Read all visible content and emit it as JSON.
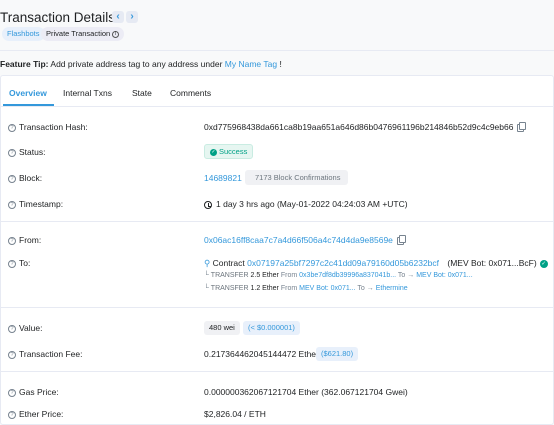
{
  "header": {
    "title": "Transaction Details",
    "prev_symbol": "‹",
    "next_symbol": "›",
    "badges": [
      "Flashbots",
      "Private Transaction"
    ]
  },
  "feature_tip": {
    "label": "Feature Tip:",
    "text": "Add private address tag to any address under",
    "link": "My Name Tag",
    "end": "!"
  },
  "tabs": [
    "Overview",
    "Internal Txns",
    "State",
    "Comments"
  ],
  "rows": {
    "tx_hash": {
      "label": "Transaction Hash:",
      "value": "0xd775968438da661ca8b19aa651a646d86b0476961196b214846b52d9c4c9eb66"
    },
    "status": {
      "label": "Status:",
      "value": "Success"
    },
    "block": {
      "label": "Block:",
      "value": "14689821",
      "confirmations": "7173 Block Confirmations"
    },
    "timestamp": {
      "label": "Timestamp:",
      "value": "1 day 3 hrs ago (May-01-2022 04:24:03 AM +UTC)"
    },
    "from": {
      "label": "From:",
      "value": "0x06ac16ff8caa7c7a4d66f506a4c74d4da9e8569e"
    },
    "to": {
      "label": "To:",
      "contract_prefix": "Contract",
      "contract_address": "0x07197a25bf7297c2c41dd09a79160d05b6232bcf",
      "contract_tag": "(MEV Bot: 0x071...BcF)",
      "transfers": [
        {
          "prefix": "TRANSFER",
          "amount": "2.5 Ether",
          "from_label": "From",
          "from": "0x3be7df8db39996a837041b...",
          "to_label": "To →",
          "to": "MEV Bot: 0x071..."
        },
        {
          "prefix": "TRANSFER",
          "amount": "1.2 Ether",
          "from_label": "From",
          "from": "MEV Bot: 0x071...",
          "to_label": "To →",
          "to": "Ethermine"
        }
      ]
    },
    "value": {
      "label": "Value:",
      "amount": "480 wei",
      "usd": "(< $0.000001)"
    },
    "fee": {
      "label": "Transaction Fee:",
      "amount": "0.217364462045144472 Ether",
      "usd": "($621.80)"
    },
    "gas_price": {
      "label": "Gas Price:",
      "value": "0.000000362067121704 Ether (362.067121704 Gwei)"
    },
    "ether_price": {
      "label": "Ether Price:",
      "value": "$2,826.04 / ETH"
    }
  },
  "colors": {
    "link": "#3498db",
    "success": "#00a186",
    "border": "#e7eaf3"
  }
}
